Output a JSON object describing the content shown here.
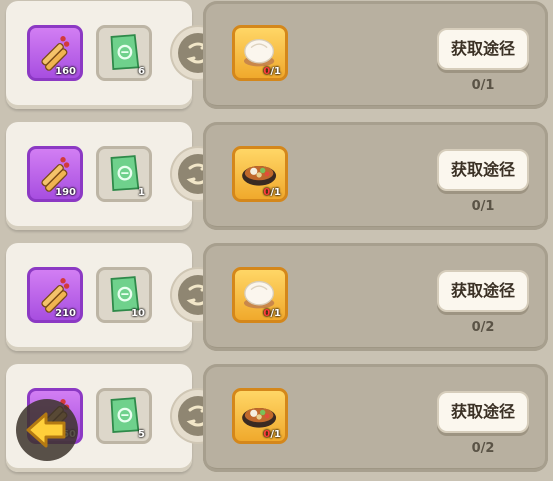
{
  "rows": [
    {
      "scroll_count": "160",
      "ticket_count": "6",
      "reward": "mantou",
      "reward_have": "0",
      "reward_need": "/1",
      "button_label": "获取途径",
      "progress": "0/1"
    },
    {
      "scroll_count": "190",
      "ticket_count": "1",
      "reward": "hotpot",
      "reward_have": "0",
      "reward_need": "/1",
      "button_label": "获取途径",
      "progress": "0/1"
    },
    {
      "scroll_count": "210",
      "ticket_count": "10",
      "reward": "mantou",
      "reward_have": "0",
      "reward_need": "/1",
      "button_label": "获取途径",
      "progress": "0/2"
    },
    {
      "scroll_count": "50",
      "ticket_count": "5",
      "reward": "hotpot",
      "reward_have": "0",
      "reward_need": "/1",
      "button_label": "获取途径",
      "progress": "0/2"
    }
  ],
  "icons": {
    "scroll": "scroll-bundle-icon",
    "ticket": "green-ticket-icon",
    "swap": "swap-arrows-icon",
    "back": "back-arrow-icon"
  },
  "colors": {
    "purple_slot": "#b458e8",
    "gold_slot": "#f5b93c",
    "missing_count": "#ff3d3d"
  }
}
